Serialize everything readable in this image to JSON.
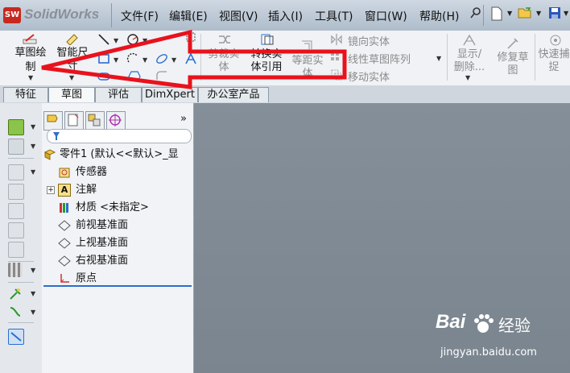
{
  "app": {
    "name": "SolidWorks",
    "logo_mark": "SW"
  },
  "menu": [
    "文件(F)",
    "编辑(E)",
    "视图(V)",
    "插入(I)",
    "工具(T)",
    "窗口(W)",
    "帮助(H)"
  ],
  "title_tools": [
    "pin-icon",
    "new-document-icon",
    "open-folder-icon",
    "save-icon"
  ],
  "commands": {
    "sketch": [
      "草图绘",
      "制"
    ],
    "smart_dim": [
      "智能尺",
      "寸"
    ],
    "trim": [
      "剪裁实",
      "体"
    ],
    "convert": [
      "转换实",
      "体引用"
    ],
    "offset": [
      "等距实",
      "体"
    ],
    "mirror": "镜向实体",
    "linear_pattern": "线性草图阵列",
    "move": "移动实体",
    "display_delete": [
      "显示/",
      "删除..."
    ],
    "repair": [
      "修复草",
      "图"
    ],
    "quick_snap": [
      "快速捕",
      "捉"
    ]
  },
  "tabs": [
    "特征",
    "草图",
    "评估",
    "DimXpert",
    "办公室产品"
  ],
  "active_tab": "草图",
  "expand_glyph": "»",
  "tree": {
    "part": "零件1 (默认<<默认>_显",
    "items": [
      "传感器",
      "注解",
      "材质 <未指定>",
      "前视基准面",
      "上视基准面",
      "右视基准面",
      "原点"
    ]
  },
  "watermark": {
    "brand": "Bai",
    "brand2": "经验",
    "url": "jingyan.baidu.com"
  },
  "colors": {
    "arrow_red": "#e8121c",
    "accent_blue": "#2a6ed0",
    "graphics_bg": "#7f8a95"
  }
}
